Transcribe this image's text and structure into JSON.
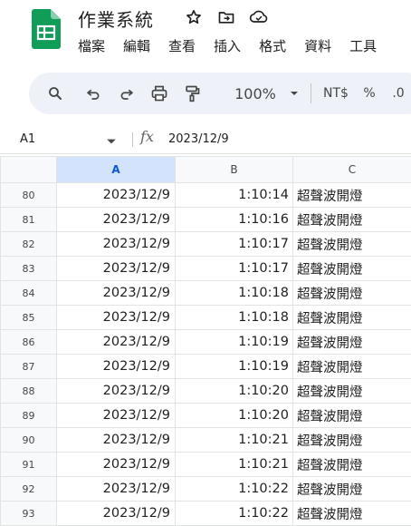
{
  "doc": {
    "title": "作業系統"
  },
  "menu": [
    "檔案",
    "編輯",
    "查看",
    "插入",
    "格式",
    "資料",
    "工具"
  ],
  "toolbar": {
    "zoom": "100%",
    "currency": "NT$",
    "percent": "%",
    "decimal": ".0"
  },
  "formula_bar": {
    "cell_ref": "A1",
    "fx": "fx",
    "value": "2023/12/9"
  },
  "columns": [
    "A",
    "B",
    "C"
  ],
  "rows": [
    {
      "num": "80",
      "date": "2023/12/9",
      "time": "1:10:14",
      "label": "超聲波開燈"
    },
    {
      "num": "81",
      "date": "2023/12/9",
      "time": "1:10:16",
      "label": "超聲波開燈"
    },
    {
      "num": "82",
      "date": "2023/12/9",
      "time": "1:10:17",
      "label": "超聲波開燈"
    },
    {
      "num": "83",
      "date": "2023/12/9",
      "time": "1:10:17",
      "label": "超聲波開燈"
    },
    {
      "num": "84",
      "date": "2023/12/9",
      "time": "1:10:18",
      "label": "超聲波開燈"
    },
    {
      "num": "85",
      "date": "2023/12/9",
      "time": "1:10:18",
      "label": "超聲波開燈"
    },
    {
      "num": "86",
      "date": "2023/12/9",
      "time": "1:10:19",
      "label": "超聲波開燈"
    },
    {
      "num": "87",
      "date": "2023/12/9",
      "time": "1:10:19",
      "label": "超聲波開燈"
    },
    {
      "num": "88",
      "date": "2023/12/9",
      "time": "1:10:20",
      "label": "超聲波開燈"
    },
    {
      "num": "89",
      "date": "2023/12/9",
      "time": "1:10:20",
      "label": "超聲波開燈"
    },
    {
      "num": "90",
      "date": "2023/12/9",
      "time": "1:10:21",
      "label": "超聲波開燈"
    },
    {
      "num": "91",
      "date": "2023/12/9",
      "time": "1:10:21",
      "label": "超聲波開燈"
    },
    {
      "num": "92",
      "date": "2023/12/9",
      "time": "1:10:22",
      "label": "超聲波開燈"
    },
    {
      "num": "93",
      "date": "2023/12/9",
      "time": "1:10:22",
      "label": "超聲波開燈"
    }
  ],
  "colors": {
    "logo_green": "#0f9d58",
    "selected_col_bg": "#d3e3fd",
    "selected_col_text": "#0b57d0",
    "toolbar_bg": "#eef2f8"
  }
}
